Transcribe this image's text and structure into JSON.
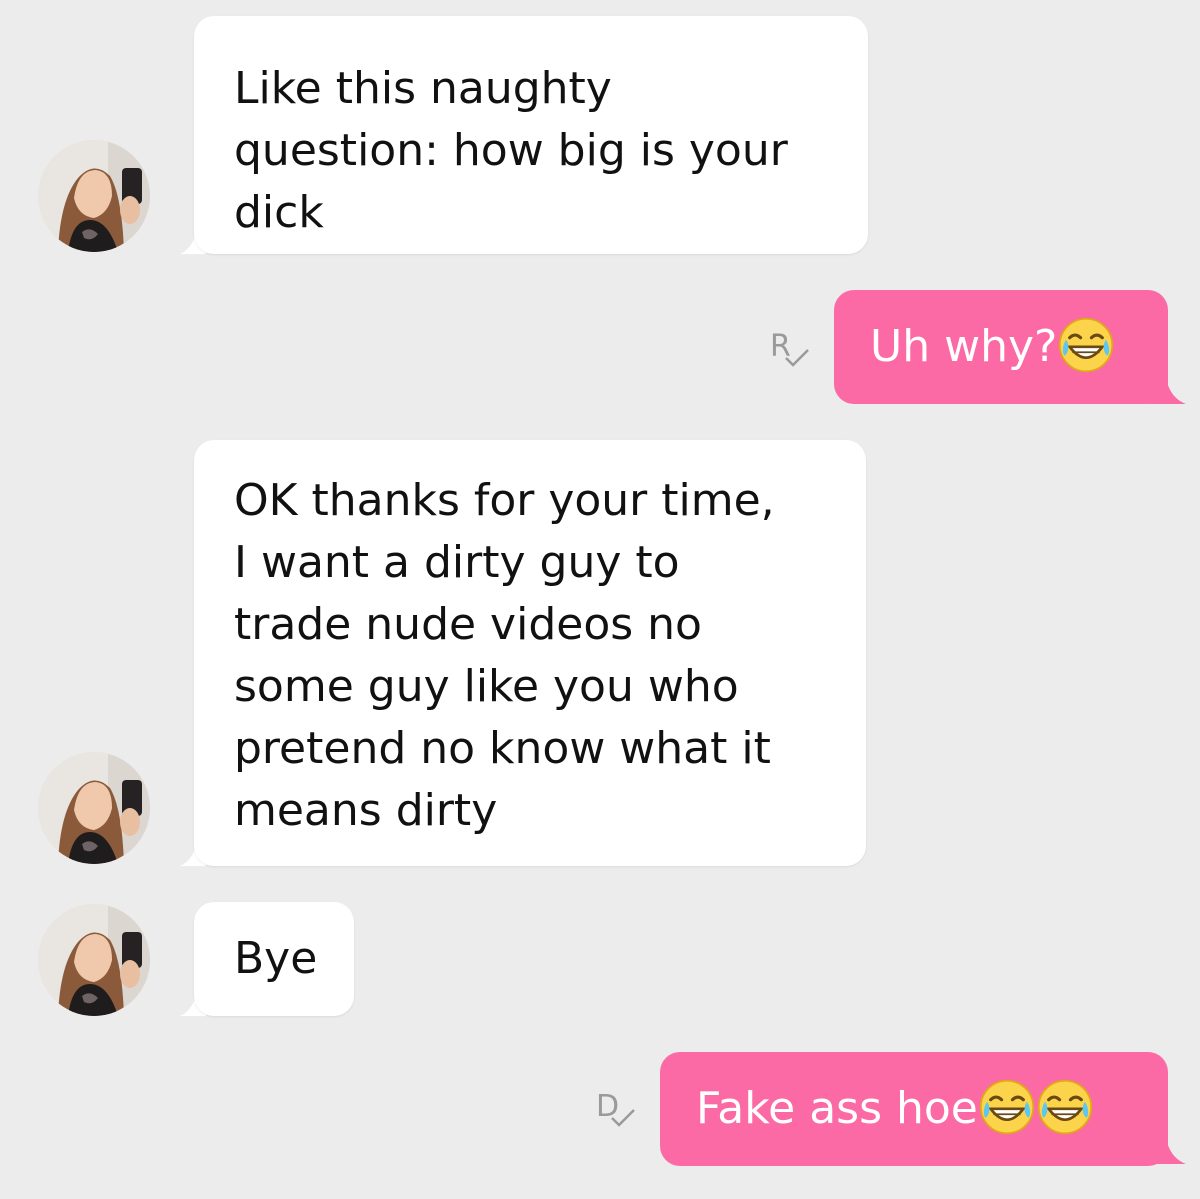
{
  "messages": [
    {
      "direction": "incoming",
      "lines": [
        "Like this naughty",
        "question: how big is your",
        "dick"
      ]
    },
    {
      "direction": "outgoing",
      "text": "Uh why?",
      "emoji": [
        "tears-of-joy-emoji"
      ],
      "status": "R"
    },
    {
      "direction": "incoming",
      "lines": [
        "OK thanks for your time,",
        "I want a dirty guy to",
        "trade nude videos no",
        "some guy like you who",
        "pretend no know what it",
        "means dirty"
      ]
    },
    {
      "direction": "incoming",
      "lines": [
        "Bye"
      ]
    },
    {
      "direction": "outgoing",
      "text": "Fake ass hoe",
      "emoji": [
        "tears-of-joy-emoji",
        "tears-of-joy-emoji"
      ],
      "status": "D"
    }
  ],
  "colors": {
    "background": "#ececec",
    "incoming_bubble": "#ffffff",
    "outgoing_bubble": "#fb6aa4",
    "status_mark": "#9a9a9a"
  }
}
